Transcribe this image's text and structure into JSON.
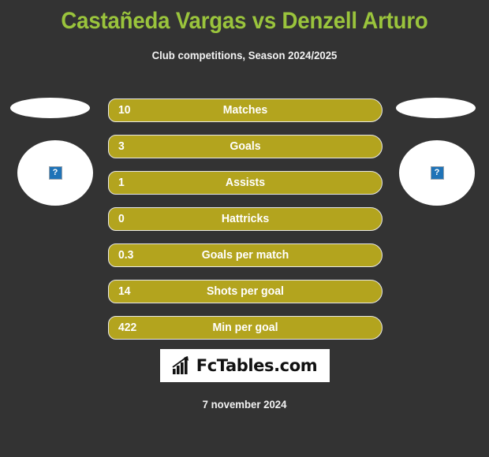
{
  "header": {
    "title": "Castañeda Vargas vs Denzell Arturo",
    "subtitle": "Club competitions, Season 2024/2025",
    "title_color": "#9ac43c",
    "subtitle_color": "#f2f2f2"
  },
  "theme": {
    "background": "#333333",
    "bar_color": "#b3a41e",
    "bar_border": "#e8e8e8",
    "bar_text": "#ffffff",
    "accent_green": "#9ac43c"
  },
  "players": {
    "left": {
      "flag": "flag-placeholder",
      "avatar_icon": "broken-image-icon",
      "avatar_glyph": "?"
    },
    "right": {
      "flag": "flag-placeholder",
      "avatar_icon": "broken-image-icon",
      "avatar_glyph": "?"
    }
  },
  "stats": [
    {
      "value": "10",
      "label": "Matches"
    },
    {
      "value": "3",
      "label": "Goals"
    },
    {
      "value": "1",
      "label": "Assists"
    },
    {
      "value": "0",
      "label": "Hattricks"
    },
    {
      "value": "0.3",
      "label": "Goals per match"
    },
    {
      "value": "14",
      "label": "Shots per goal"
    },
    {
      "value": "422",
      "label": "Min per goal"
    }
  ],
  "footer": {
    "logo_text": "FcTables.com",
    "logo_icon": "bar-chart-growth-icon",
    "date": "7 november 2024"
  }
}
